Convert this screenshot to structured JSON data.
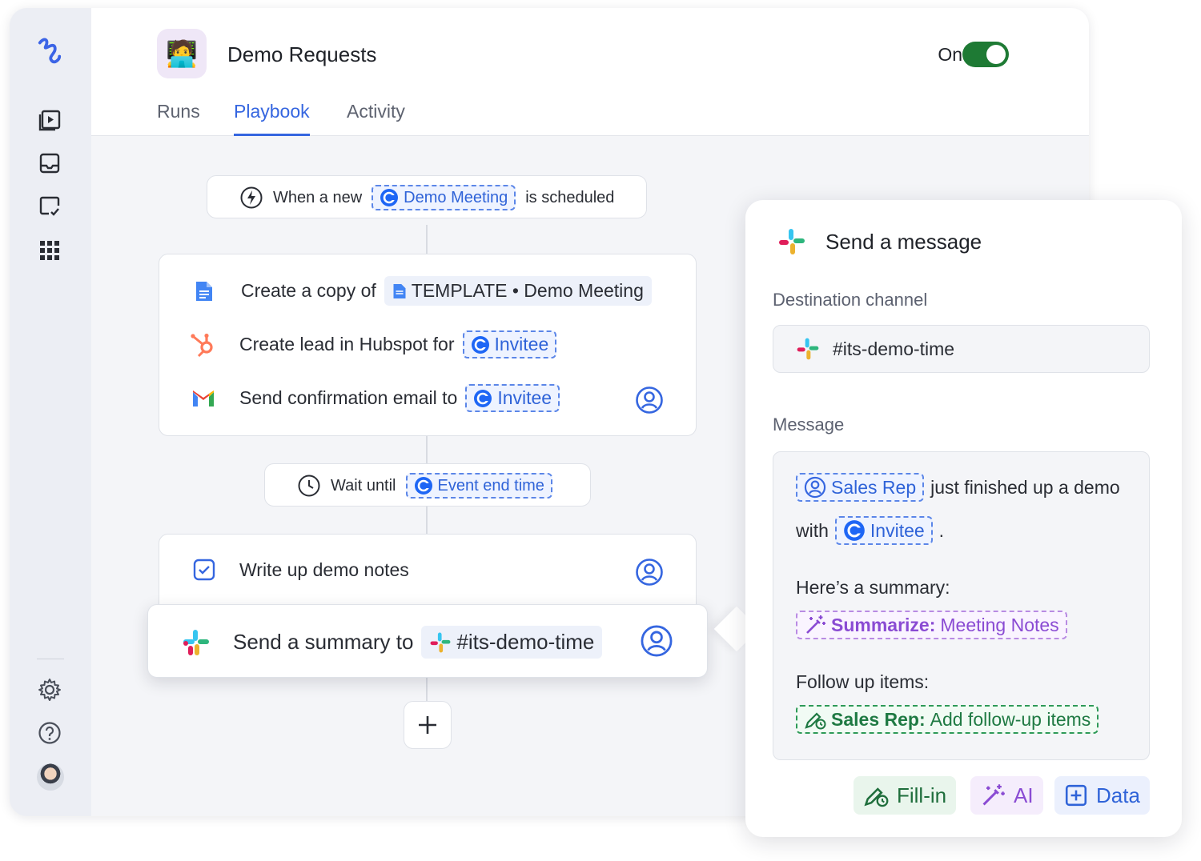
{
  "header": {
    "title": "Demo Requests",
    "toggle_label": "On",
    "tabs": [
      {
        "label": "Runs"
      },
      {
        "label": "Playbook"
      },
      {
        "label": "Activity"
      }
    ]
  },
  "sidebar": {
    "items": [
      "logo-icon",
      "runs-icon",
      "inbox-icon",
      "tasks-icon",
      "apps-grid-icon",
      "settings-icon",
      "help-icon",
      "user-avatar"
    ]
  },
  "playbook": {
    "trigger": {
      "prefix": "When a new",
      "chip": "Demo Meeting",
      "suffix": "is scheduled"
    },
    "step_group_1": [
      {
        "text": "Create a copy of",
        "chip": "TEMPLATE • Demo Meeting"
      },
      {
        "text": "Create lead in Hubspot for",
        "chip": "Invitee"
      },
      {
        "text": "Send confirmation email to",
        "chip": "Invitee"
      }
    ],
    "wait": {
      "prefix": "Wait until",
      "chip": "Event end time"
    },
    "step_notes": {
      "text": "Write up demo notes"
    },
    "step_slack": {
      "text": "Send a summary to",
      "chip": "#its-demo-time"
    }
  },
  "panel": {
    "title": "Send a message",
    "destination_label": "Destination channel",
    "destination_value": "#its-demo-time",
    "message_label": "Message",
    "message": {
      "rep_chip": "Sales Rep",
      "line1_rest": "just finished up a demo",
      "line2_prefix": "with",
      "invitee_chip": "Invitee",
      "line2_suffix": ".",
      "summary_label": "Here’s a summary:",
      "summarize_chip_bold": "Summarize:",
      "summarize_chip_rest": "Meeting Notes",
      "followup_label": "Follow up items:",
      "followup_chip_bold": "Sales Rep:",
      "followup_chip_rest": "Add follow-up items"
    },
    "buttons": {
      "fillin": "Fill-in",
      "ai": "AI",
      "data": "Data"
    }
  }
}
